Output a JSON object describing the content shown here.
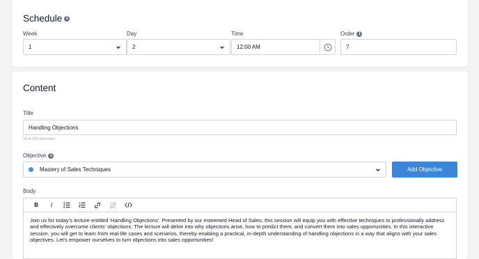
{
  "schedule": {
    "title": "Schedule",
    "week": {
      "label": "Week",
      "value": "1"
    },
    "day": {
      "label": "Day",
      "value": "2"
    },
    "time": {
      "label": "Time",
      "value": "12:00 AM"
    },
    "order": {
      "label": "Order",
      "value": "7"
    }
  },
  "content": {
    "title": "Content",
    "title_field": {
      "label": "Title",
      "value": "Handling Objections",
      "helper": "19 of 100 characters"
    },
    "objective": {
      "label": "Objective",
      "value": "Mastery of Sales Techniques",
      "dot_color": "#3b9be8",
      "add_button": "Add Objective"
    },
    "body": {
      "label": "Body",
      "toolbar": {
        "bold": "B",
        "italic": "I",
        "icons": [
          "bold-icon",
          "italic-icon",
          "bullet-list-icon",
          "numbered-list-icon",
          "link-icon",
          "unlink-icon",
          "code-icon"
        ]
      },
      "text": "Join us for today's lecture entitled 'Handling Objections'. Presented by our esteemed Head of Sales, this session will equip you with effective techniques to professionally address and effectively overcome clients' objections. The lecture will delve into why objections arise, how to predict them, and convert them into sales opportunities. In this interactive session, you will get to learn from real-life cases and scenarios, thereby enabling a practical, in-depth understanding of handling objections in a way that aligns with your sales objectives. Let's empower ourselves to turn objections into sales opportunities!"
    }
  },
  "colors": {
    "accent": "#3b86db",
    "border": "#d1d5db",
    "page_bg": "#f3f4f6"
  }
}
